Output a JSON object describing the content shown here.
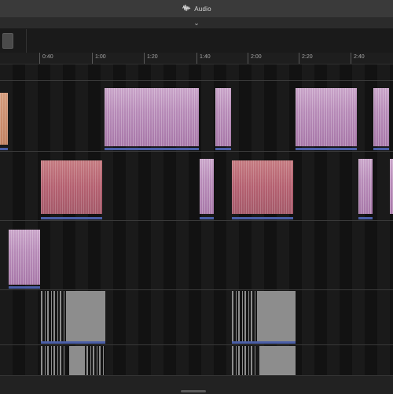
{
  "window": {
    "title": "Audio"
  },
  "ruler": {
    "labels": [
      "0:40",
      "1:00",
      "1:20",
      "1:40",
      "2:00",
      "2:20",
      "2:40"
    ]
  },
  "icons": {
    "audio": "waveform-icon",
    "collapse": "chevron-down-icon"
  },
  "colors": {
    "clip_pink": "#b78bb8",
    "clip_red": "#b46070",
    "clip_orange": "#c28060",
    "region_bar": "#4b5fa8",
    "gray_clip": "#8d8d8d"
  }
}
